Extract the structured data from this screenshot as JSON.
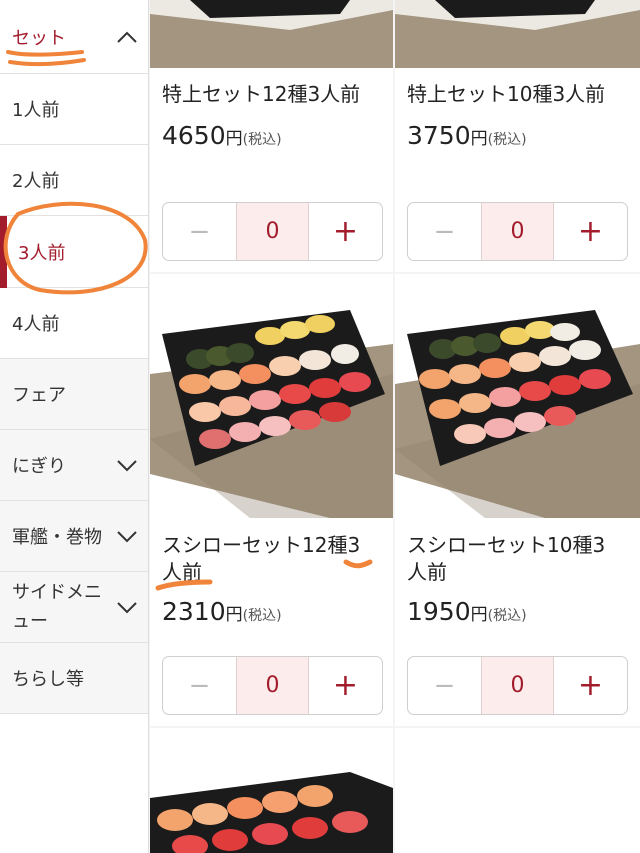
{
  "sidebar": {
    "items": [
      {
        "label": "セット",
        "expanded": true
      },
      {
        "label": "1人前"
      },
      {
        "label": "2人前"
      },
      {
        "label": "3人前",
        "selected": true
      },
      {
        "label": "4人前"
      },
      {
        "label": "フェア"
      },
      {
        "label": "にぎり",
        "chevron": "chevron-down-icon"
      },
      {
        "label": "軍艦・巻物",
        "chevron": "chevron-down-icon"
      },
      {
        "label": "サイドメニュー",
        "label_line1": "サイドメニ",
        "label_line2": "ュー",
        "chevron": "chevron-down-icon"
      },
      {
        "label": "ちらし等"
      }
    ]
  },
  "products": [
    {
      "name": "特上セット12種3人前",
      "price": "4650",
      "yen": "円",
      "tax": "(税込)",
      "qty": "0"
    },
    {
      "name": "特上セット10種3人前",
      "price": "3750",
      "yen": "円",
      "tax": "(税込)",
      "qty": "0"
    },
    {
      "name": "スシローセット12種3人前",
      "name_line1": "スシローセット12種3",
      "name_line2": "人前",
      "price": "2310",
      "yen": "円",
      "tax": "(税込)",
      "qty": "0"
    },
    {
      "name": "スシローセット10種3人前",
      "name_line1": "スシローセット10種3",
      "name_line2": "人前",
      "price": "1950",
      "yen": "円",
      "tax": "(税込)",
      "qty": "0"
    }
  ],
  "stepper": {
    "minus": "−",
    "plus": "+"
  },
  "colors": {
    "accent": "#a21c2c",
    "annotation": "#f0843a",
    "qty_bg": "#fcecec"
  }
}
